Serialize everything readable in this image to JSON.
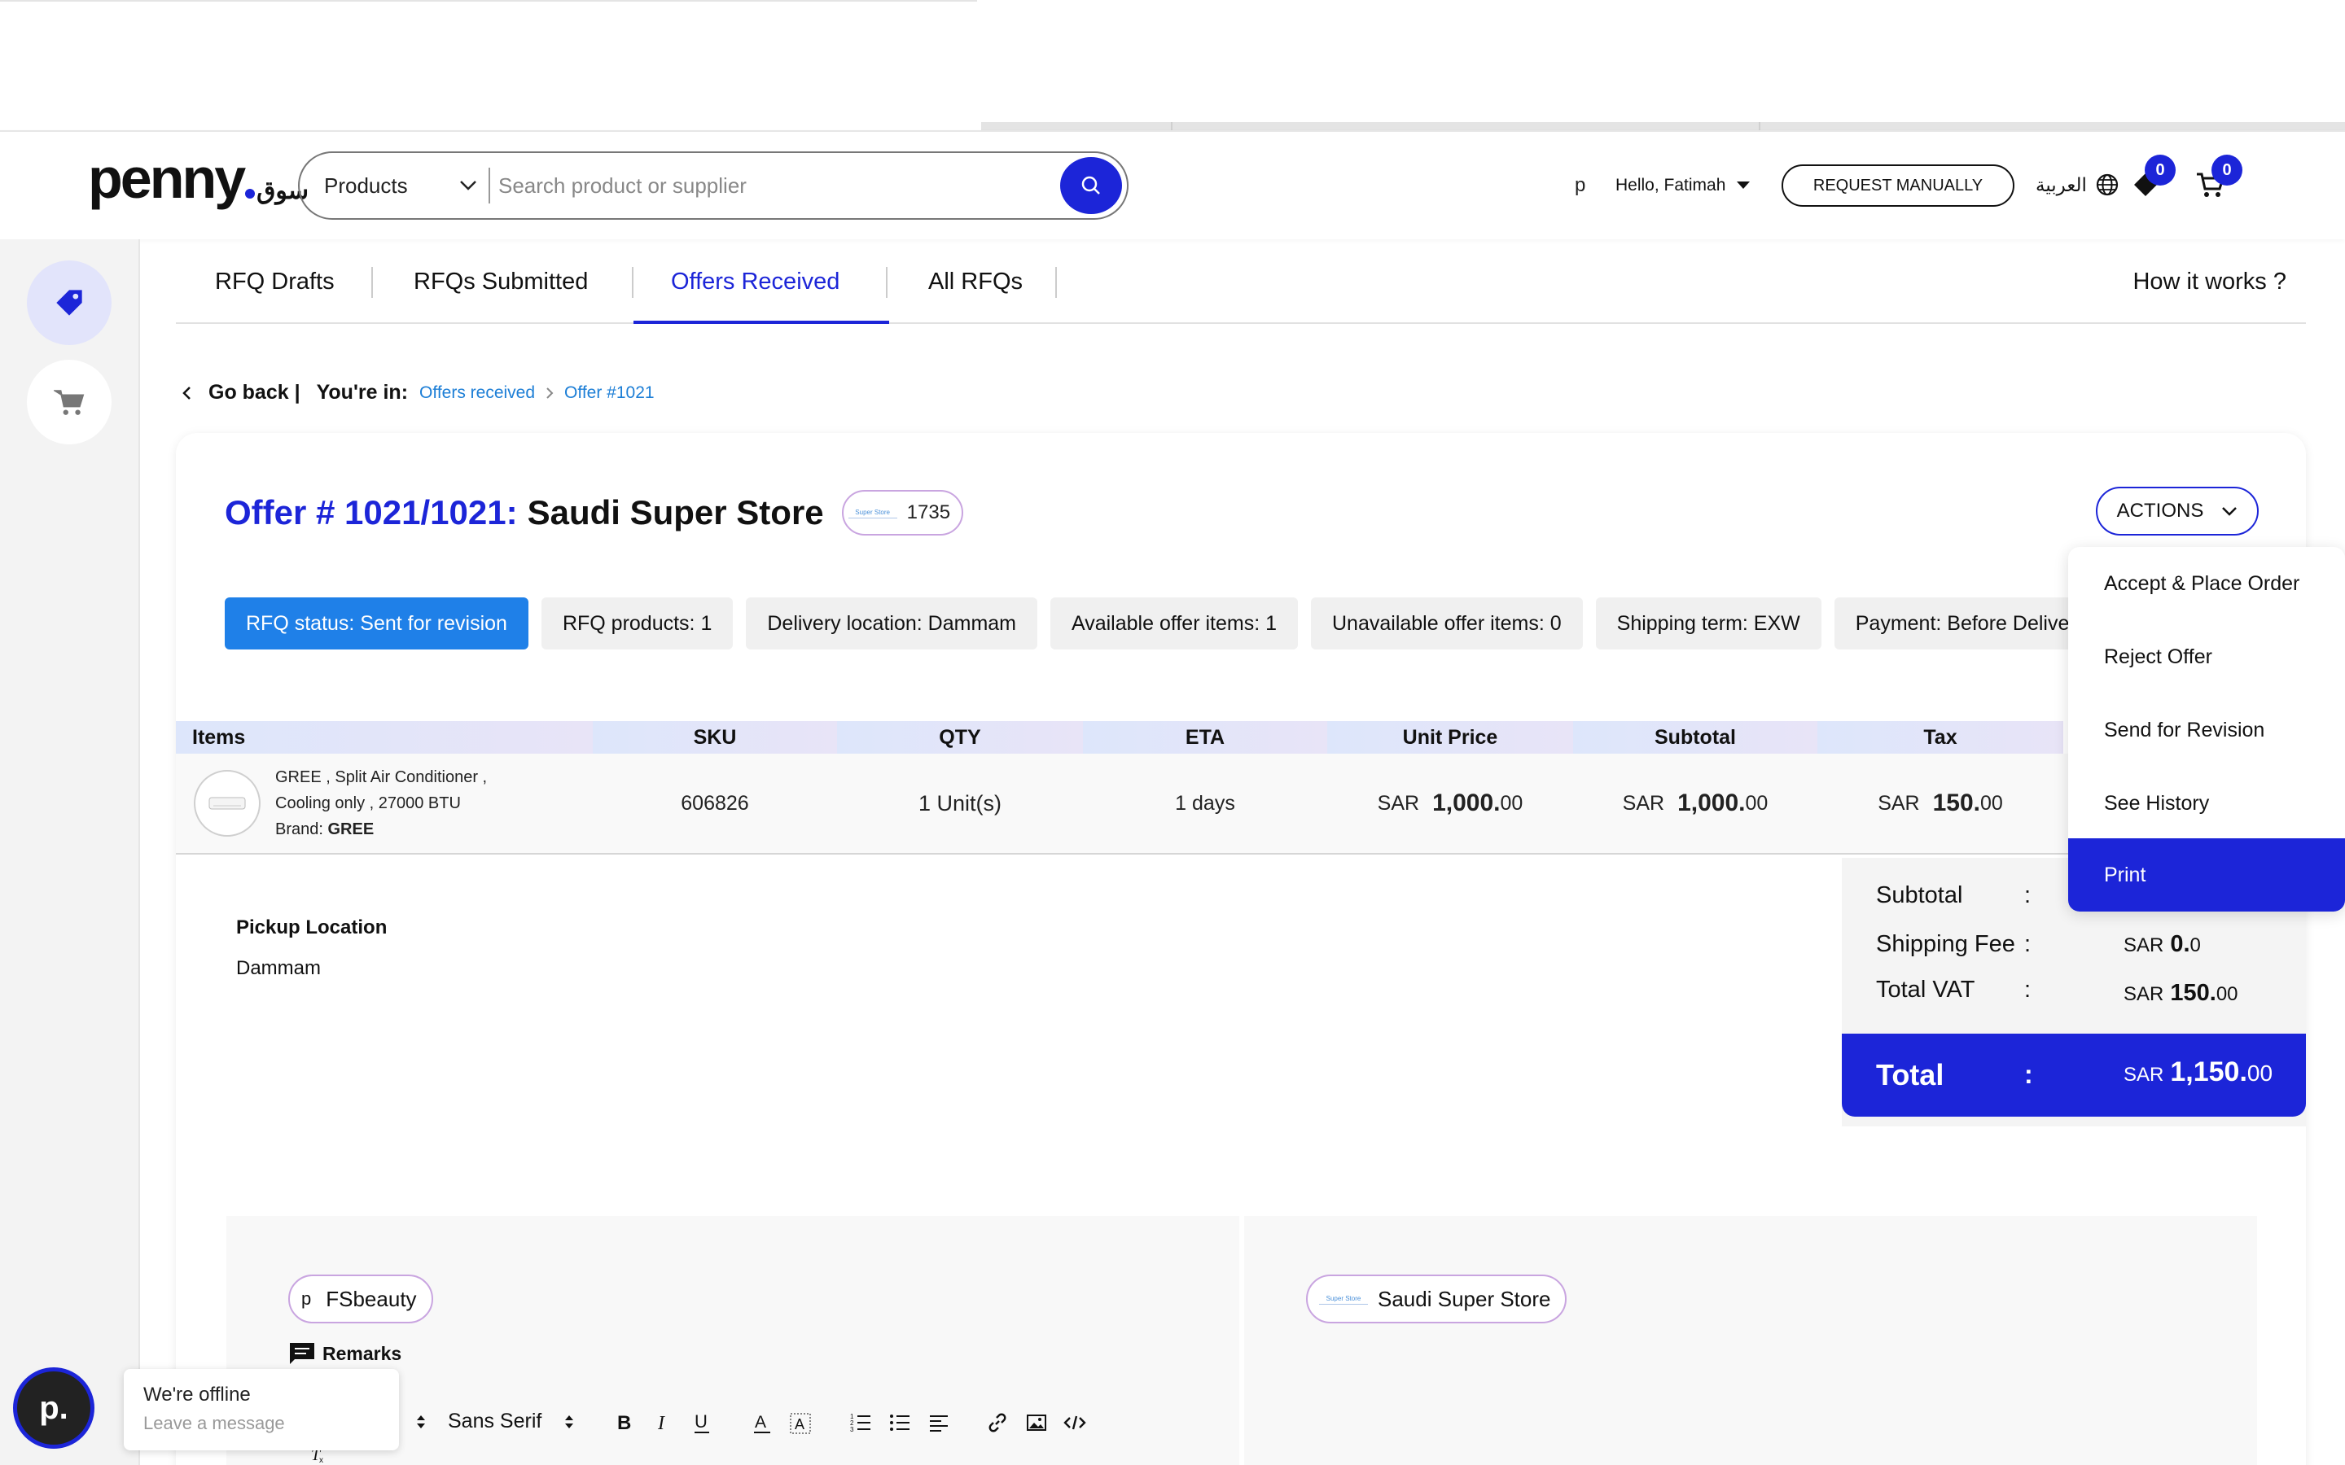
{
  "header": {
    "logo_en": "penny",
    "logo_ar": "سوق",
    "search_category": "Products",
    "search_placeholder": "Search product or supplier",
    "user_initial": "p",
    "user_greeting": "Hello, Fatimah",
    "request_button": "REQUEST MANUALLY",
    "language": "العربية",
    "wishlist_count": "0",
    "cart_count": "0"
  },
  "tabs": {
    "items": [
      "RFQ Drafts",
      "RFQs Submitted",
      "Offers Received",
      "All RFQs"
    ],
    "active": "Offers Received",
    "help": "How it works ?"
  },
  "breadcrumb": {
    "back": "Go back |",
    "youre_in": "You're in:",
    "level1": "Offers received",
    "level2": "Offer #1021"
  },
  "offer": {
    "number": "Offer # 1021/1021:",
    "supplier": "Saudi Super Store",
    "supplier_logo_text": "Super Store",
    "supplier_code": "1735",
    "actions_label": "ACTIONS"
  },
  "chips": [
    "RFQ status: Sent for revision",
    "RFQ products: 1",
    "Delivery location: Dammam",
    "Available offer items: 1",
    "Unavailable offer items: 0",
    "Shipping term: EXW",
    "Payment: Before Delivery"
  ],
  "table": {
    "headers": [
      "Items",
      "SKU",
      "QTY",
      "ETA",
      "Unit Price",
      "Subtotal",
      "Tax"
    ],
    "row": {
      "name_line1": "GREE , Split Air Conditioner ,",
      "name_line2": "Cooling only , 27000 BTU",
      "brand_label": "Brand:",
      "brand": "GREE",
      "sku": "606826",
      "qty": "1 Unit(s)",
      "eta": "1 days",
      "unit_price_cur": "SAR",
      "unit_price_int": "1,000.",
      "unit_price_dec": "00",
      "subtotal_cur": "SAR",
      "subtotal_int": "1,000.",
      "subtotal_dec": "00",
      "tax_cur": "SAR",
      "tax_int": "150.",
      "tax_dec": "00"
    }
  },
  "pickup": {
    "label": "Pickup Location",
    "value": "Dammam"
  },
  "totals": {
    "subtotal_label": "Subtotal",
    "shipping_label": "Shipping Fee",
    "shipping_cur": "SAR",
    "shipping_int": "0.",
    "shipping_dec": "0",
    "vat_label": "Total VAT",
    "vat_cur": "SAR",
    "vat_int": "150.",
    "vat_dec": "00",
    "total_label": "Total",
    "total_cur": "SAR",
    "total_int": "1,150.",
    "total_dec": "00",
    "colon": ":"
  },
  "actions_menu": [
    "Accept & Place Order",
    "Reject Offer",
    "Send for Revision",
    "See History",
    "Print"
  ],
  "actions_menu_active": "Print",
  "remarks": {
    "buyer_initial": "p",
    "buyer_name": "FSbeauty",
    "supplier_name": "Saudi Super Store",
    "title": "Remarks",
    "font_name": "Sans Serif"
  },
  "chat": {
    "initial": "p.",
    "status": "We're offline",
    "cta": "Leave a message"
  },
  "colors": {
    "brand_blue": "#1c25d8",
    "status_blue": "#1f80e8",
    "link_blue": "#1c7ed6"
  }
}
